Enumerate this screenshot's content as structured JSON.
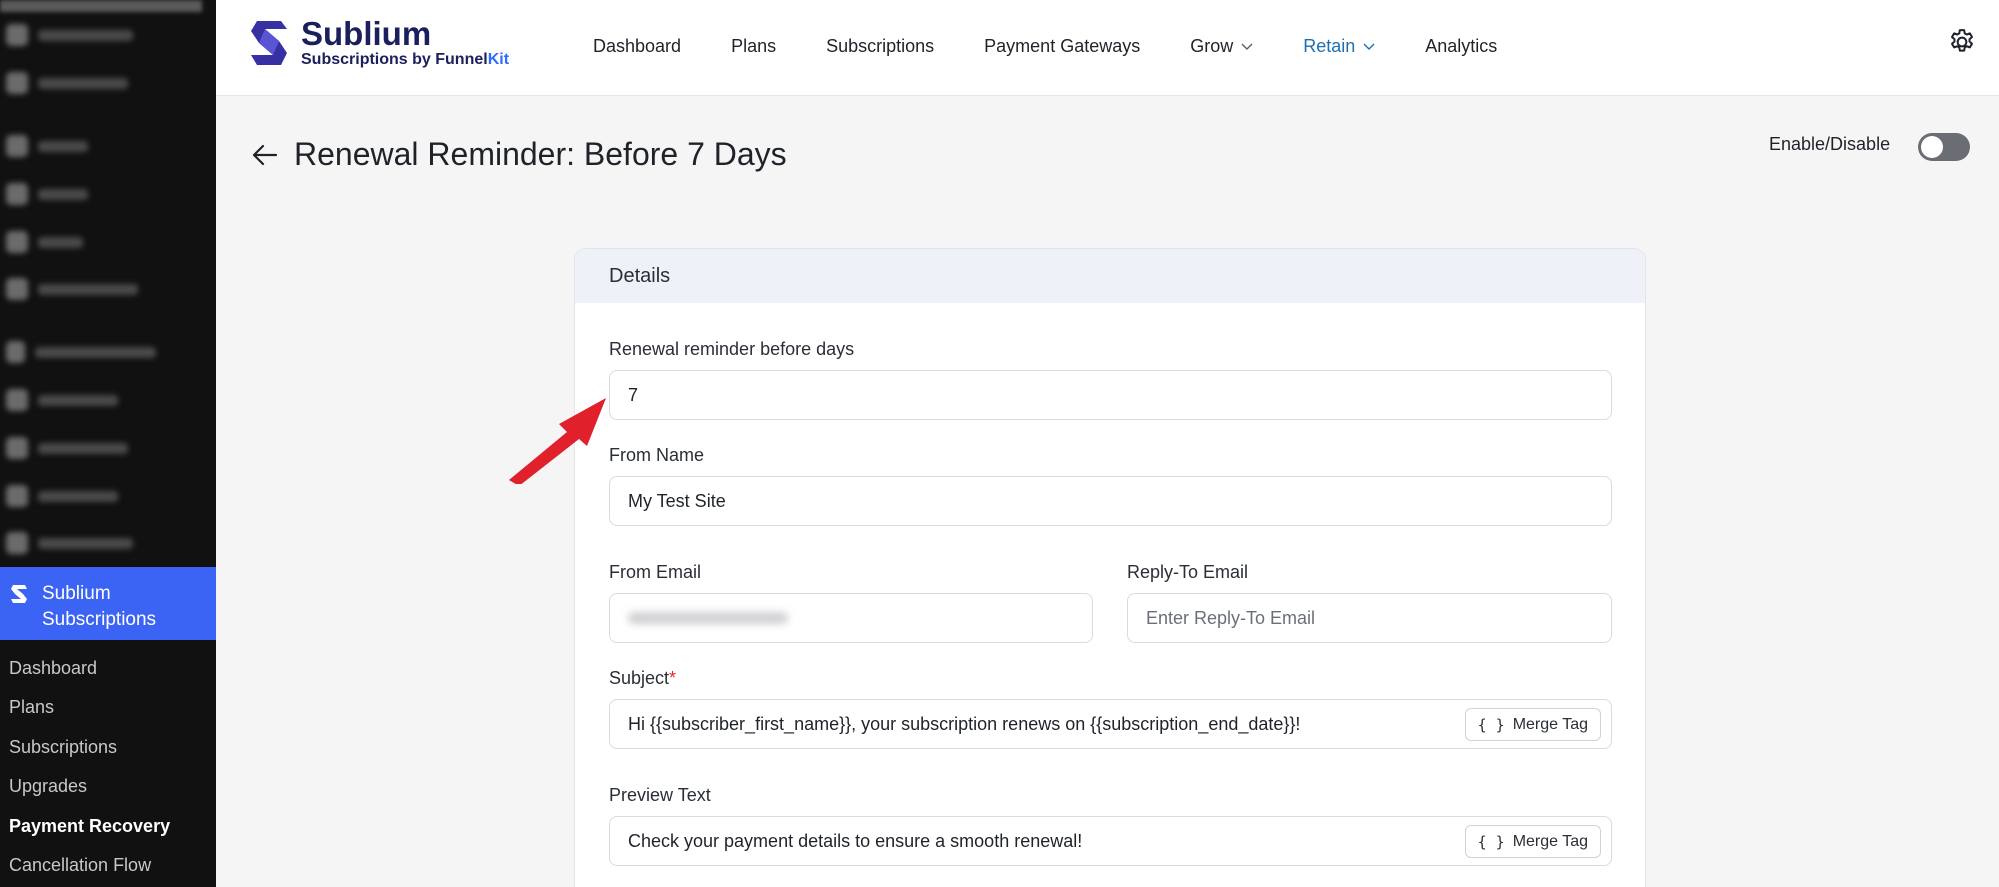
{
  "sidebar": {
    "active_item": "Sublium Subscriptions",
    "sub_items": [
      {
        "label": "Dashboard",
        "bold": false
      },
      {
        "label": "Plans",
        "bold": false
      },
      {
        "label": "Subscriptions",
        "bold": false
      },
      {
        "label": "Upgrades",
        "bold": false
      },
      {
        "label": "Payment Recovery",
        "bold": true
      },
      {
        "label": "Cancellation Flow",
        "bold": false
      }
    ]
  },
  "brand": {
    "name": "Sublium",
    "byline_prefix": "Subscriptions by ",
    "byline_funnel": "Funnel",
    "byline_kit": "Kit"
  },
  "nav": {
    "items": [
      {
        "label": "Dashboard"
      },
      {
        "label": "Plans"
      },
      {
        "label": "Subscriptions"
      },
      {
        "label": "Payment Gateways"
      },
      {
        "label": "Grow"
      },
      {
        "label": "Retain"
      },
      {
        "label": "Analytics"
      }
    ],
    "active": "Retain"
  },
  "page": {
    "title": "Renewal Reminder: Before 7 Days",
    "toggle_label": "Enable/Disable",
    "toggle_on": false
  },
  "card": {
    "header": "Details",
    "renewal_label": "Renewal reminder before days",
    "renewal_value": "7",
    "from_name_label": "From Name",
    "from_name_value": "My Test Site",
    "from_email_label": "From Email",
    "from_email_value": "",
    "reply_to_label": "Reply-To Email",
    "reply_to_placeholder": "Enter Reply-To Email",
    "subject_label": "Subject",
    "subject_required_mark": "*",
    "subject_value": "Hi {{subscriber_first_name}}, your subscription renews on {{subscription_end_date}}!",
    "preview_label": "Preview Text",
    "preview_value": "Check your payment details to ensure a smooth renewal!",
    "merge_tag_label": "Merge Tag",
    "merge_tag_braces": "{ }"
  },
  "colors": {
    "accent_blue": "#3c64f4",
    "nav_active": "#1d6fb0",
    "annotation_red": "#e0202a",
    "brand_navy": "#1b1f5c"
  }
}
